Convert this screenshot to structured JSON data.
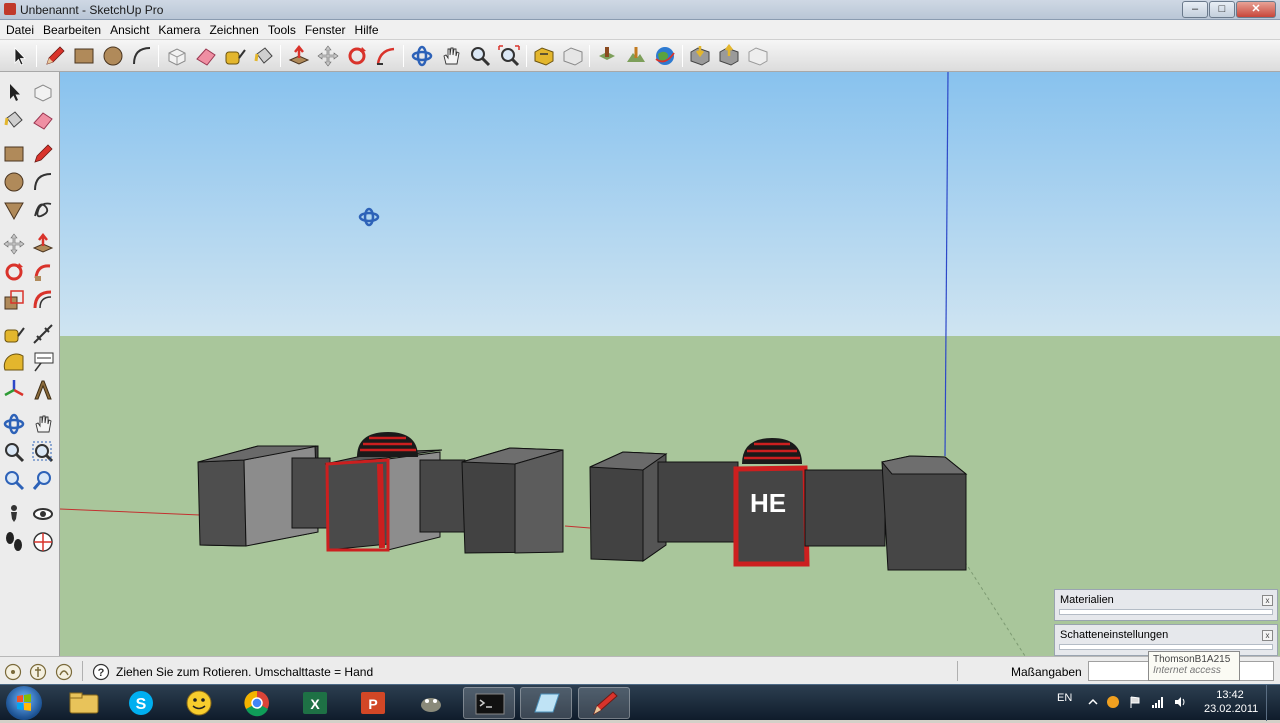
{
  "window": {
    "title": "Unbenannt - SketchUp Pro",
    "minimize_glyph": "‒",
    "maximize_glyph": "□",
    "close_glyph": "✕"
  },
  "menu": [
    "Datei",
    "Bearbeiten",
    "Ansicht",
    "Kamera",
    "Zeichnen",
    "Tools",
    "Fenster",
    "Hilfe"
  ],
  "toolbar_icons": [
    "select-icon",
    "pencil-icon",
    "rectangle-icon",
    "circle-icon",
    "arc-icon",
    "make-component-icon",
    "eraser-icon",
    "tape-measure-icon",
    "paint-bucket-icon",
    "push-pull-icon",
    "move-icon",
    "rotate-icon",
    "follow-me-icon",
    "orbit-icon",
    "pan-icon",
    "zoom-icon",
    "zoom-extents-icon",
    "get-models-icon",
    "share-model-icon",
    "add-location-icon",
    "toggle-terrain-icon",
    "google-earth-icon",
    "photo-textures-icon",
    "get-component-icon",
    "share-component-icon"
  ],
  "left_toolbar_icons": [
    "select-icon",
    "make-component-icon",
    "paint-bucket-icon",
    "eraser-icon",
    "rectangle-icon",
    "line-icon",
    "circle-icon",
    "arc-icon",
    "polygon-icon",
    "freehand-icon",
    "move-icon",
    "push-pull-icon",
    "rotate-icon",
    "follow-me-icon",
    "scale-icon",
    "offset-icon",
    "tape-measure-icon",
    "dimension-icon",
    "protractor-icon",
    "text-icon",
    "axes-icon",
    "3d-text-icon",
    "orbit-icon",
    "pan-icon",
    "zoom-icon",
    "zoom-window-icon",
    "previous-view-icon",
    "next-view-icon",
    "position-camera-icon",
    "look-around-icon",
    "walk-icon",
    "section-plane-icon"
  ],
  "viewport": {
    "model_text": "HE",
    "colors": {
      "sky": "#a9d4f2",
      "ground": "#a9c69b",
      "box": "#4c4c4c",
      "accent": "#cc1f1f",
      "blue_axis": "#2d48c8",
      "red_axis": "#c33030"
    }
  },
  "panels": [
    {
      "title": "Materialien",
      "close": "x"
    },
    {
      "title": "Schatteneinstellungen",
      "close": "x"
    }
  ],
  "tooltip": {
    "line1": "ThomsonB1A215",
    "line2": "Internet access"
  },
  "statusbar": {
    "hint": "Ziehen Sie zum Rotieren.  Umschalttaste = Hand",
    "help_glyph": "?",
    "vcb_label": "Maßangaben",
    "vcb_value": ""
  },
  "taskbar": {
    "apps": [
      "explorer-icon",
      "skype-icon",
      "messenger-icon",
      "chrome-icon",
      "excel-icon",
      "powerpoint-icon",
      "gimp-icon",
      "console-icon",
      "notes-icon",
      "sketchup-icon"
    ],
    "language": "EN",
    "time": "13:42",
    "date": "23.02.2011"
  }
}
